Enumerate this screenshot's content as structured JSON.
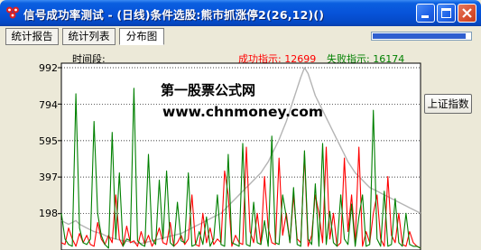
{
  "window": {
    "title": "信号成功率测试 - (日线)条件选股:熊市抓涨停2(26,12)()"
  },
  "tabs": [
    {
      "label": "统计报告",
      "active": false
    },
    {
      "label": "统计列表",
      "active": false
    },
    {
      "label": "分布图",
      "active": true
    }
  ],
  "progress": {
    "fraction": 0.95
  },
  "chart_header": {
    "time_label": "时间段:",
    "success_label": "成功指示: 12699",
    "fail_label": "失败指示: 16174"
  },
  "watermark": {
    "line1": "第一股票公式网",
    "line2": "www.chnmoney.com"
  },
  "buttons": {
    "index": "上证指数"
  },
  "colors": {
    "success": "#008000",
    "fail": "#FF0000",
    "index_line": "#B4B4B4",
    "success_label": "#FF0000",
    "fail_label": "#008000"
  },
  "chart_data": {
    "type": "line",
    "yticks": [
      "992",
      "794",
      "595",
      "397",
      "198"
    ],
    "ylim": [
      0,
      992
    ],
    "x": [
      0,
      1,
      2,
      3,
      4,
      5,
      6,
      7,
      8,
      9,
      10,
      11,
      12,
      13,
      14,
      15,
      16,
      17,
      18,
      19,
      20,
      21,
      22,
      23,
      24,
      25,
      26,
      27,
      28,
      29,
      30,
      31,
      32,
      33,
      34,
      35,
      36,
      37,
      38,
      39,
      40,
      41,
      42,
      43,
      44,
      45,
      46,
      47,
      48,
      49,
      50,
      51,
      52,
      53,
      54,
      55,
      56,
      57,
      58,
      59,
      60,
      61,
      62,
      63,
      64,
      65,
      66,
      67,
      68,
      69,
      70,
      71,
      72,
      73,
      74,
      75,
      76,
      77,
      78,
      79,
      80,
      81,
      82,
      83,
      84,
      85,
      86,
      87,
      88,
      89,
      90,
      91,
      92,
      93,
      94,
      95,
      96,
      97,
      98,
      99
    ],
    "series": [
      {
        "color": "#008000",
        "values": [
          200,
          60,
          30,
          20,
          850,
          120,
          40,
          30,
          60,
          700,
          200,
          80,
          30,
          10,
          640,
          60,
          420,
          20,
          60,
          50,
          880,
          50,
          30,
          20,
          520,
          60,
          30,
          380,
          60,
          430,
          40,
          20,
          260,
          50,
          40,
          420,
          20,
          30,
          100,
          30,
          180,
          20,
          60,
          300,
          30,
          20,
          520,
          40,
          30,
          20,
          580,
          30,
          20,
          260,
          40,
          30,
          160,
          20,
          620,
          40,
          30,
          300,
          180,
          40,
          340,
          30,
          20,
          540,
          60,
          30,
          360,
          20,
          580,
          30,
          210,
          40,
          20,
          300,
          60,
          30,
          250,
          20,
          180,
          300,
          20,
          30,
          760,
          60,
          20,
          320,
          20,
          30,
          280,
          40,
          20,
          200,
          30,
          20,
          20,
          10
        ]
      },
      {
        "color": "#FF0000",
        "values": [
          40,
          30,
          120,
          60,
          20,
          90,
          40,
          80,
          30,
          20,
          150,
          60,
          30,
          80,
          40,
          300,
          60,
          20,
          130,
          40,
          50,
          20,
          100,
          30,
          80,
          20,
          60,
          120,
          40,
          30,
          150,
          20,
          40,
          80,
          30,
          60,
          300,
          30,
          20,
          200,
          40,
          120,
          30,
          60,
          40,
          430,
          300,
          20,
          80,
          40,
          30,
          560,
          100,
          40,
          200,
          30,
          400,
          120,
          40,
          30,
          500,
          80,
          200,
          40,
          300,
          60,
          40,
          520,
          20,
          80,
          300,
          200,
          40,
          560,
          60,
          200,
          20,
          40,
          500,
          100,
          300,
          40,
          560,
          20,
          100,
          40,
          200,
          300,
          60,
          20,
          400,
          80,
          40,
          200,
          30,
          20,
          100,
          40,
          20,
          10
        ]
      },
      {
        "color": "#B4B4B4",
        "values": [
          160,
          150,
          140,
          150,
          160,
          140,
          130,
          120,
          110,
          100,
          95,
          90,
          80,
          70,
          65,
          60,
          55,
          50,
          48,
          45,
          40,
          38,
          36,
          40,
          45,
          50,
          55,
          60,
          65,
          70,
          75,
          80,
          85,
          90,
          100,
          110,
          120,
          130,
          140,
          150,
          160,
          170,
          180,
          190,
          200,
          220,
          240,
          260,
          280,
          300,
          320,
          340,
          360,
          380,
          400,
          420,
          450,
          480,
          520,
          560,
          600,
          650,
          700,
          760,
          820,
          880,
          940,
          992,
          960,
          900,
          840,
          800,
          760,
          720,
          680,
          640,
          600,
          560,
          520,
          480,
          450,
          420,
          400,
          380,
          360,
          340,
          330,
          320,
          310,
          300,
          290,
          280,
          270,
          260,
          250,
          240,
          230,
          220,
          210,
          200
        ]
      }
    ]
  }
}
